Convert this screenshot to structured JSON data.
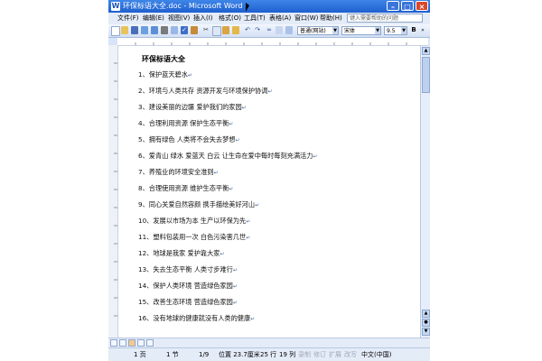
{
  "window": {
    "title": "环保标语大全.doc - Microsoft Word"
  },
  "menu": {
    "items": [
      "文件(F)",
      "编辑(E)",
      "视图(V)",
      "插入(I)",
      "格式(O)",
      "工具(T)",
      "表格(A)",
      "窗口(W)",
      "帮助(H)"
    ],
    "help_placeholder": "键入需要帮助的问题"
  },
  "toolbar": {
    "style_value": "普通(网站)",
    "font_value": "宋体",
    "size_value": "9.5"
  },
  "document": {
    "title": "环保标语大全",
    "lines": [
      "1、保护蓝天碧水",
      "2、环境与人类共存  资源开发与环境保护协调",
      "3、建设美丽的边疆  爱护我们的家园",
      "4、合理利用资源  保护生态平衡",
      "5、拥有绿色  人类将不会失去梦想",
      "6、爱青山 绿水 爱蓝天 白云 让生命在爱中每时每刻充满活力",
      "7、养殖业的环境安全准则",
      "8、合理使用资源  维护生态平衡",
      "9、同心关爱自然容颜  携手描绘美好河山",
      "10、发展以市场为本  生产以环保为先",
      "11、塑料包装用一次  白色污染害几世",
      "12、地球是我家  爱护靠大家",
      "13、失去生态平衡  人类寸步难行",
      "14、保护人类环境  营造绿色家园",
      "15、改善生态环境  营造绿色家园",
      "16、没有地球的健康就没有人类的健康"
    ]
  },
  "status": {
    "page": "1 页",
    "section": "1 节",
    "page_of": "1/9",
    "position": "位置 23.7厘米",
    "line": "25 行",
    "column": "19 列",
    "rec": "录制",
    "trk": "修订",
    "ext": "扩展",
    "ovr": "改写",
    "language": "中文(中国)"
  },
  "colors": {
    "titlebar": "#2a6ad8",
    "chrome": "#d8e4f8",
    "close": "#d8472a"
  }
}
